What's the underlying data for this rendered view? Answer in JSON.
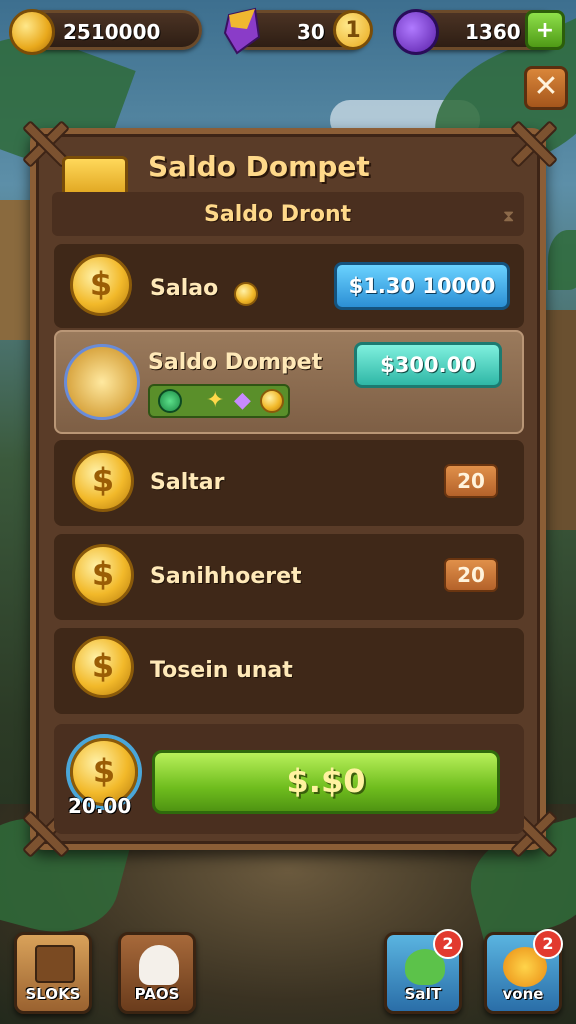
{
  "resources": {
    "coins": "2510000",
    "gems": "30",
    "energy": "1360"
  },
  "panel": {
    "title": "Saldo Dompet",
    "subtitle": "Saldo Dront"
  },
  "rows": [
    {
      "label": "Salao",
      "value": "$1.30 10000"
    },
    {
      "label": "Saldo Dompet",
      "value": "$300.00"
    },
    {
      "label": "Saltar",
      "value": "20"
    },
    {
      "label": "Sanihhoeret",
      "value": "20"
    },
    {
      "label": "Tosein  unat",
      "value": ""
    }
  ],
  "purchase": {
    "price": "20.00",
    "button_label": "$.$0"
  },
  "nav": [
    {
      "label": "SLOKS",
      "badge": ""
    },
    {
      "label": "PAOS",
      "badge": ""
    },
    {
      "label": "SaIT",
      "badge": "2"
    },
    {
      "label": "vone",
      "badge": "2"
    }
  ],
  "icons": {
    "close": "✕",
    "add": "+",
    "gem_plus": "1"
  },
  "colors": {
    "panel_bg": "#5a3c28",
    "panel_border": "#8c5e36",
    "title_text": "#ffd98a",
    "green_button": "#6fbd1e",
    "blue_pill": "#2c8fd4",
    "teal_pill": "#2fb7a6",
    "badge_red": "#e23a2f"
  }
}
